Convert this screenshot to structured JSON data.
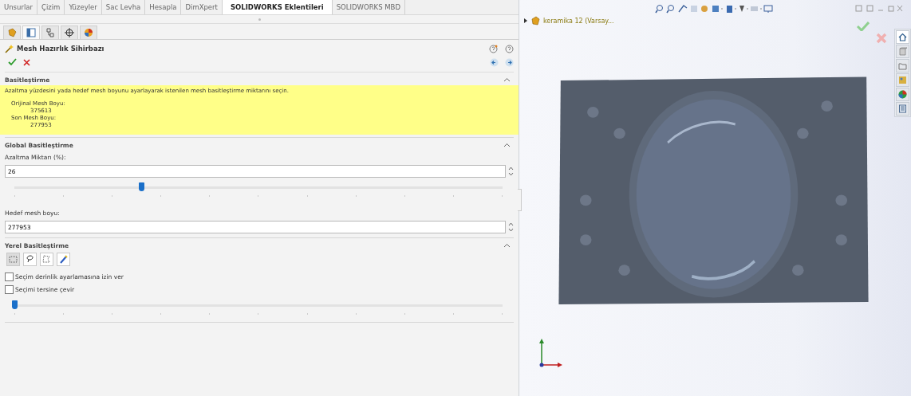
{
  "command_tabs": [
    {
      "label": "Unsurlar",
      "selected": false
    },
    {
      "label": "Çizim",
      "selected": false
    },
    {
      "label": "Yüzeyler",
      "selected": false
    },
    {
      "label": "Sac Levha",
      "selected": false
    },
    {
      "label": "Hesapla",
      "selected": false
    },
    {
      "label": "DimXpert",
      "selected": false
    },
    {
      "label": "SOLIDWORKS Eklentileri",
      "selected": true
    },
    {
      "label": "SOLIDWORKS MBD",
      "selected": false
    }
  ],
  "panel_tabs": [
    {
      "selected": false
    },
    {
      "selected": true
    },
    {
      "selected": false
    },
    {
      "selected": false
    },
    {
      "selected": false
    }
  ],
  "property_manager": {
    "title": "Mesh Hazırlık Sihirbazı",
    "sections": [
      {
        "kind": "info",
        "title": "Basitleştirme",
        "expanded": true,
        "message": "Azaltma yüzdesini yada hedef mesh boyunu ayarlayarak istenilen mesh basitleştirme miktarını seçin.",
        "lines": [
          {
            "label": "Orijinal Mesh Boyu:",
            "value": "375613"
          },
          {
            "label": "Son Mesh Boyu:",
            "value": "277953"
          }
        ]
      },
      {
        "kind": "global",
        "title": "Global Basitleştirme",
        "expanded": true,
        "percent_label": "Azaltma Miktarı (%):",
        "percent_value": "26",
        "slider": {
          "level": 0.26
        },
        "target_label": "Hedef mesh boyu:",
        "target_value": "277953"
      },
      {
        "kind": "local",
        "title": "Yerel Basitleştirme",
        "expanded": true,
        "tools": [
          {
            "selected": true
          },
          {
            "selected": false
          },
          {
            "selected": false
          },
          {
            "selected": false
          }
        ],
        "options": [
          {
            "label": "Seçim derinlik ayarlamasına izin ver",
            "checked": false
          },
          {
            "label": "Seçimi tersine çevir",
            "checked": false
          }
        ],
        "slider": {
          "level": 0
        }
      }
    ]
  },
  "viewport": {
    "tree_item": "keramika 12  (Varsay...",
    "task_pane_tabs": [
      {
        "selected": true
      },
      {
        "selected": false
      },
      {
        "selected": false
      },
      {
        "selected": false
      },
      {
        "selected": false
      },
      {
        "selected": false
      }
    ]
  }
}
